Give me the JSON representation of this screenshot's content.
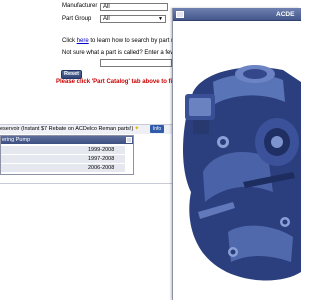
{
  "form": {
    "manufacturer_label": "Manufacturer",
    "manufacturer_value": "All",
    "part_group_label": "Part Group",
    "part_group_value": "All",
    "help_prefix": "Click ",
    "help_link": "here",
    "help_suffix": " to learn how to search by part num",
    "unsure_text": "Not sure what a part is called? Enter a few ke",
    "reset_label": "Reset",
    "notice": "Please click 'Part Catalog' tab above to find y"
  },
  "results": {
    "header_text": "eservoir (Instant $7 Rebate on ACDelco Reman parts!)",
    "info_label": "Info",
    "title": "ering Pump",
    "years": [
      "1999-2008",
      "1997-2008",
      "2006-2008"
    ]
  },
  "popup": {
    "title": "ACDE"
  }
}
